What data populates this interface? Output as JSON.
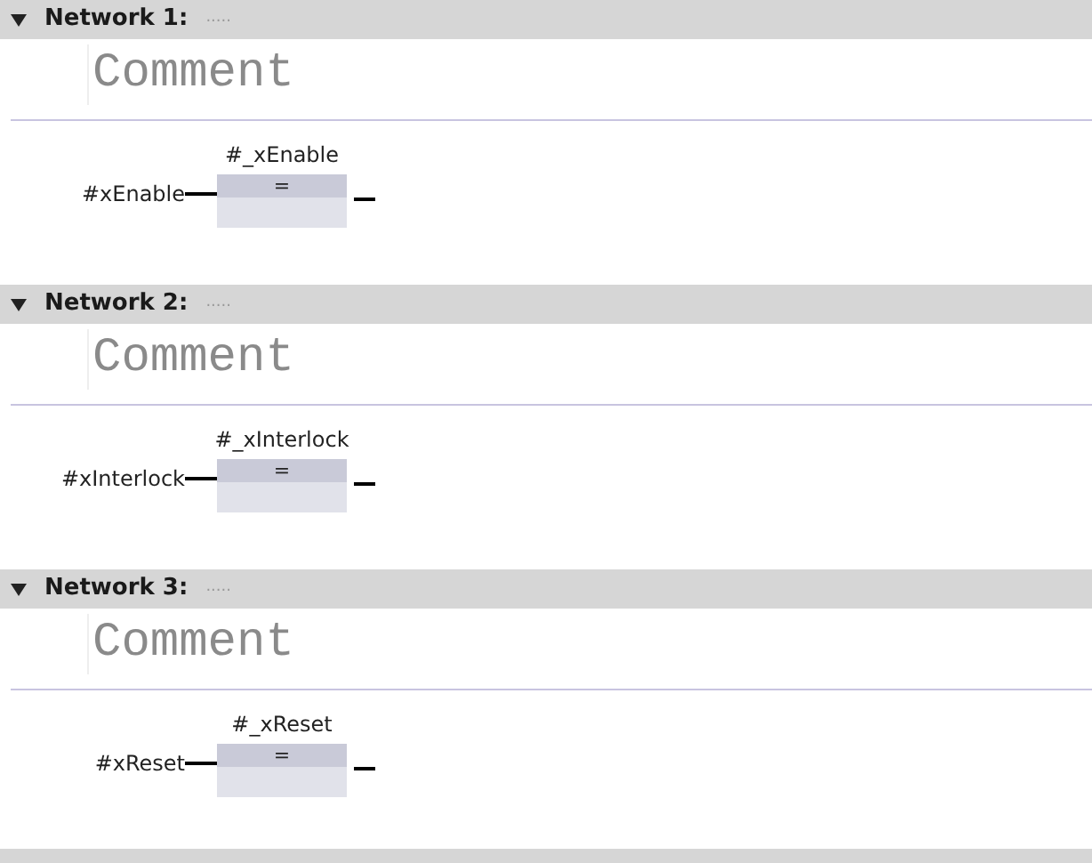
{
  "networks": [
    {
      "title": "Network 1:",
      "dots": ".....",
      "expanded": true,
      "comment": "Comment",
      "block": {
        "operand": "#_xEnable",
        "operator": "=",
        "input": "#xEnable"
      }
    },
    {
      "title": "Network 2:",
      "dots": ".....",
      "expanded": true,
      "comment": "Comment",
      "block": {
        "operand": "#_xInterlock",
        "operator": "=",
        "input": "#xInterlock"
      }
    },
    {
      "title": "Network 3:",
      "dots": ".....",
      "expanded": true,
      "comment": "Comment",
      "block": {
        "operand": "#_xReset",
        "operator": "=",
        "input": "#xReset"
      }
    }
  ]
}
